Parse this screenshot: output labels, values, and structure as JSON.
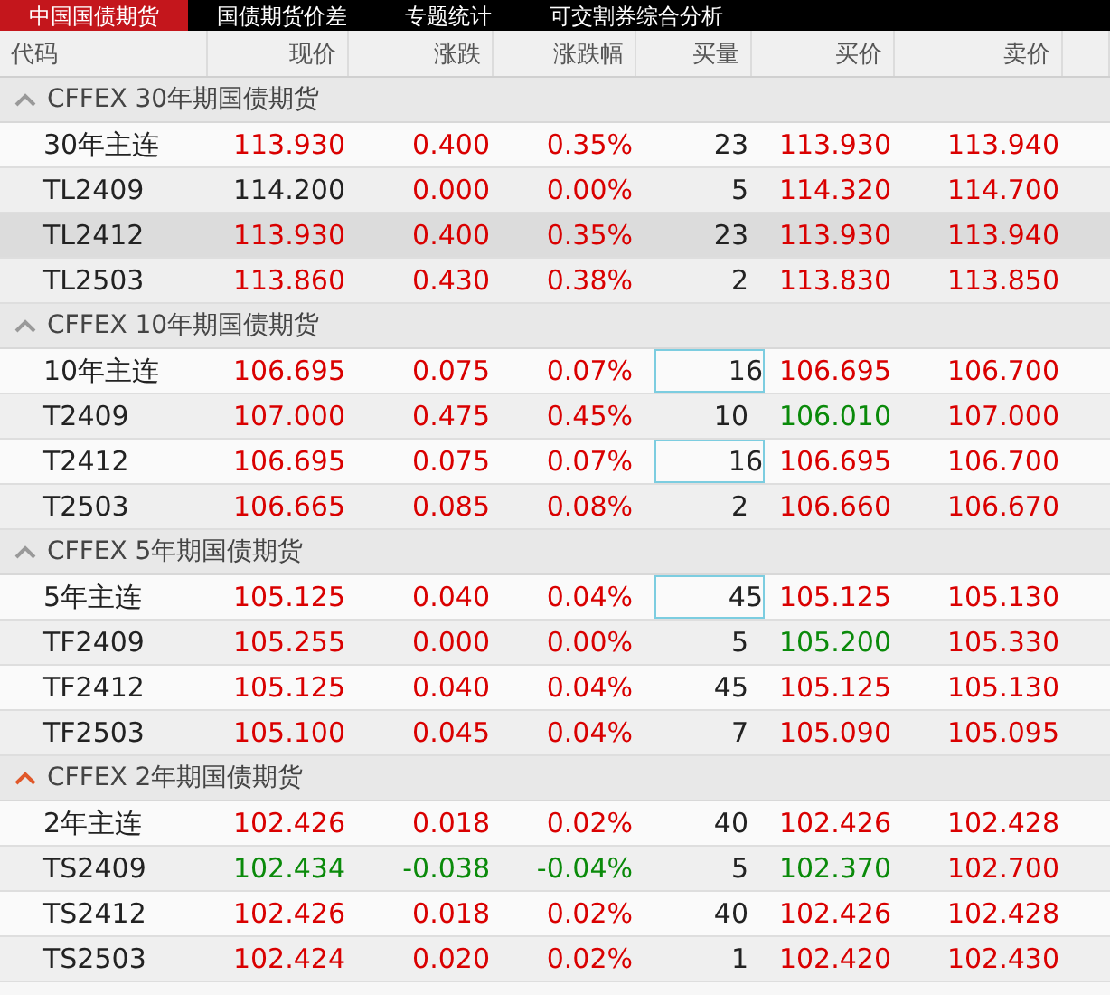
{
  "tabs": [
    {
      "label": "中国国债期货",
      "selected": true
    },
    {
      "label": "国债期货价差",
      "selected": false
    },
    {
      "label": "专题统计",
      "selected": false
    },
    {
      "label": "可交割券综合分析",
      "selected": false
    }
  ],
  "columns": [
    "代码",
    "现价",
    "涨跌",
    "涨跌幅",
    "买量",
    "买价",
    "卖价"
  ],
  "groups": [
    {
      "title": "CFFEX 30年期国债期货",
      "highlighted": false,
      "rows": [
        {
          "code": "30年主连",
          "selected": false,
          "cells": [
            {
              "text": "113.930",
              "color": "#d90000"
            },
            {
              "text": "0.400",
              "color": "#d90000"
            },
            {
              "text": "0.35%",
              "color": "#d90000"
            },
            {
              "text": "23",
              "color": "#222222",
              "boxed": false
            },
            {
              "text": "113.930",
              "color": "#d90000"
            },
            {
              "text": "113.940",
              "color": "#d90000"
            }
          ]
        },
        {
          "code": "TL2409",
          "selected": false,
          "cells": [
            {
              "text": "114.200",
              "color": "#222222"
            },
            {
              "text": "0.000",
              "color": "#d90000"
            },
            {
              "text": "0.00%",
              "color": "#d90000"
            },
            {
              "text": "5",
              "color": "#222222",
              "boxed": false
            },
            {
              "text": "114.320",
              "color": "#d90000"
            },
            {
              "text": "114.700",
              "color": "#d90000"
            }
          ]
        },
        {
          "code": "TL2412",
          "selected": true,
          "cells": [
            {
              "text": "113.930",
              "color": "#d90000"
            },
            {
              "text": "0.400",
              "color": "#d90000"
            },
            {
              "text": "0.35%",
              "color": "#d90000"
            },
            {
              "text": "23",
              "color": "#222222",
              "boxed": false
            },
            {
              "text": "113.930",
              "color": "#d90000"
            },
            {
              "text": "113.940",
              "color": "#d90000"
            }
          ]
        },
        {
          "code": "TL2503",
          "selected": false,
          "cells": [
            {
              "text": "113.860",
              "color": "#d90000"
            },
            {
              "text": "0.430",
              "color": "#d90000"
            },
            {
              "text": "0.38%",
              "color": "#d90000"
            },
            {
              "text": "2",
              "color": "#222222",
              "boxed": false
            },
            {
              "text": "113.830",
              "color": "#d90000"
            },
            {
              "text": "113.850",
              "color": "#d90000"
            }
          ]
        }
      ]
    },
    {
      "title": "CFFEX 10年期国债期货",
      "highlighted": false,
      "rows": [
        {
          "code": "10年主连",
          "selected": false,
          "cells": [
            {
              "text": "106.695",
              "color": "#d90000"
            },
            {
              "text": "0.075",
              "color": "#d90000"
            },
            {
              "text": "0.07%",
              "color": "#d90000"
            },
            {
              "text": "16",
              "color": "#222222",
              "boxed": true
            },
            {
              "text": "106.695",
              "color": "#d90000"
            },
            {
              "text": "106.700",
              "color": "#d90000"
            }
          ]
        },
        {
          "code": "T2409",
          "selected": false,
          "cells": [
            {
              "text": "107.000",
              "color": "#d90000"
            },
            {
              "text": "0.475",
              "color": "#d90000"
            },
            {
              "text": "0.45%",
              "color": "#d90000"
            },
            {
              "text": "10",
              "color": "#222222",
              "boxed": false
            },
            {
              "text": "106.010",
              "color": "#0a8a0a"
            },
            {
              "text": "107.000",
              "color": "#d90000"
            }
          ]
        },
        {
          "code": "T2412",
          "selected": false,
          "cells": [
            {
              "text": "106.695",
              "color": "#d90000"
            },
            {
              "text": "0.075",
              "color": "#d90000"
            },
            {
              "text": "0.07%",
              "color": "#d90000"
            },
            {
              "text": "16",
              "color": "#222222",
              "boxed": true
            },
            {
              "text": "106.695",
              "color": "#d90000"
            },
            {
              "text": "106.700",
              "color": "#d90000"
            }
          ]
        },
        {
          "code": "T2503",
          "selected": false,
          "cells": [
            {
              "text": "106.665",
              "color": "#d90000"
            },
            {
              "text": "0.085",
              "color": "#d90000"
            },
            {
              "text": "0.08%",
              "color": "#d90000"
            },
            {
              "text": "2",
              "color": "#222222",
              "boxed": false
            },
            {
              "text": "106.660",
              "color": "#d90000"
            },
            {
              "text": "106.670",
              "color": "#d90000"
            }
          ]
        }
      ]
    },
    {
      "title": "CFFEX 5年期国债期货",
      "highlighted": false,
      "rows": [
        {
          "code": "5年主连",
          "selected": false,
          "cells": [
            {
              "text": "105.125",
              "color": "#d90000"
            },
            {
              "text": "0.040",
              "color": "#d90000"
            },
            {
              "text": "0.04%",
              "color": "#d90000"
            },
            {
              "text": "45",
              "color": "#222222",
              "boxed": true
            },
            {
              "text": "105.125",
              "color": "#d90000"
            },
            {
              "text": "105.130",
              "color": "#d90000"
            }
          ]
        },
        {
          "code": "TF2409",
          "selected": false,
          "cells": [
            {
              "text": "105.255",
              "color": "#d90000"
            },
            {
              "text": "0.000",
              "color": "#d90000"
            },
            {
              "text": "0.00%",
              "color": "#d90000"
            },
            {
              "text": "5",
              "color": "#222222",
              "boxed": false
            },
            {
              "text": "105.200",
              "color": "#0a8a0a"
            },
            {
              "text": "105.330",
              "color": "#d90000"
            }
          ]
        },
        {
          "code": "TF2412",
          "selected": false,
          "cells": [
            {
              "text": "105.125",
              "color": "#d90000"
            },
            {
              "text": "0.040",
              "color": "#d90000"
            },
            {
              "text": "0.04%",
              "color": "#d90000"
            },
            {
              "text": "45",
              "color": "#222222",
              "boxed": false
            },
            {
              "text": "105.125",
              "color": "#d90000"
            },
            {
              "text": "105.130",
              "color": "#d90000"
            }
          ]
        },
        {
          "code": "TF2503",
          "selected": false,
          "cells": [
            {
              "text": "105.100",
              "color": "#d90000"
            },
            {
              "text": "0.045",
              "color": "#d90000"
            },
            {
              "text": "0.04%",
              "color": "#d90000"
            },
            {
              "text": "7",
              "color": "#222222",
              "boxed": false
            },
            {
              "text": "105.090",
              "color": "#d90000"
            },
            {
              "text": "105.095",
              "color": "#d90000"
            }
          ]
        }
      ]
    },
    {
      "title": "CFFEX 2年期国债期货",
      "highlighted": true,
      "rows": [
        {
          "code": "2年主连",
          "selected": false,
          "cells": [
            {
              "text": "102.426",
              "color": "#d90000"
            },
            {
              "text": "0.018",
              "color": "#d90000"
            },
            {
              "text": "0.02%",
              "color": "#d90000"
            },
            {
              "text": "40",
              "color": "#222222",
              "boxed": false
            },
            {
              "text": "102.426",
              "color": "#d90000"
            },
            {
              "text": "102.428",
              "color": "#d90000"
            }
          ]
        },
        {
          "code": "TS2409",
          "selected": false,
          "cells": [
            {
              "text": "102.434",
              "color": "#0a8a0a"
            },
            {
              "text": "-0.038",
              "color": "#0a8a0a"
            },
            {
              "text": "-0.04%",
              "color": "#0a8a0a"
            },
            {
              "text": "5",
              "color": "#222222",
              "boxed": false
            },
            {
              "text": "102.370",
              "color": "#0a8a0a"
            },
            {
              "text": "102.700",
              "color": "#d90000"
            }
          ]
        },
        {
          "code": "TS2412",
          "selected": false,
          "cells": [
            {
              "text": "102.426",
              "color": "#d90000"
            },
            {
              "text": "0.018",
              "color": "#d90000"
            },
            {
              "text": "0.02%",
              "color": "#d90000"
            },
            {
              "text": "40",
              "color": "#222222",
              "boxed": false
            },
            {
              "text": "102.426",
              "color": "#d90000"
            },
            {
              "text": "102.428",
              "color": "#d90000"
            }
          ]
        },
        {
          "code": "TS2503",
          "selected": false,
          "cells": [
            {
              "text": "102.424",
              "color": "#d90000"
            },
            {
              "text": "0.020",
              "color": "#d90000"
            },
            {
              "text": "0.02%",
              "color": "#d90000"
            },
            {
              "text": "1",
              "color": "#222222",
              "boxed": false
            },
            {
              "text": "102.420",
              "color": "#d90000"
            },
            {
              "text": "102.430",
              "color": "#d90000"
            }
          ]
        }
      ]
    }
  ]
}
